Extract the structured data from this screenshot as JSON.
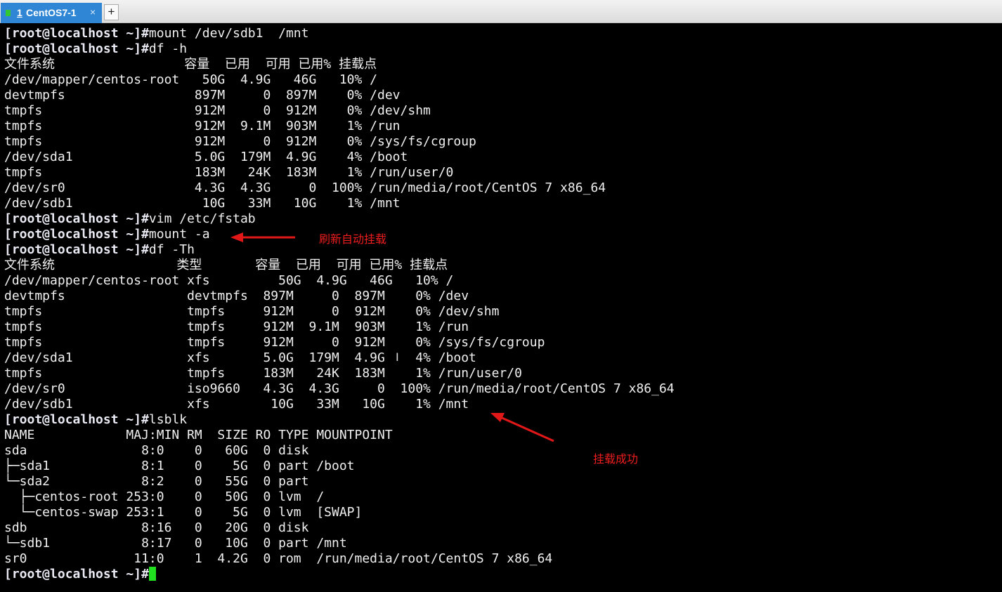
{
  "tab": {
    "number": "1",
    "title": "CentOS7-1",
    "close": "×",
    "new": "+"
  },
  "colors": {
    "tab_active": "#2f86d4",
    "status_dot": "#34c734",
    "annotation": "#f01e1e",
    "cursor": "#20e020"
  },
  "prompt": "[root@localhost ~]#",
  "lines": [
    {
      "prompt": "[root@localhost ~]#",
      "cmd": "mount /dev/sdb1  /mnt"
    },
    {
      "prompt": "[root@localhost ~]#",
      "cmd": "df -h"
    },
    {
      "text": "文件系统                 容量  已用  可用 已用% 挂载点"
    },
    {
      "text": "/dev/mapper/centos-root   50G  4.9G   46G   10% /"
    },
    {
      "text": "devtmpfs                 897M     0  897M    0% /dev"
    },
    {
      "text": "tmpfs                    912M     0  912M    0% /dev/shm"
    },
    {
      "text": "tmpfs                    912M  9.1M  903M    1% /run"
    },
    {
      "text": "tmpfs                    912M     0  912M    0% /sys/fs/cgroup"
    },
    {
      "text": "/dev/sda1                5.0G  179M  4.9G    4% /boot"
    },
    {
      "text": "tmpfs                    183M   24K  183M    1% /run/user/0"
    },
    {
      "text": "/dev/sr0                 4.3G  4.3G     0  100% /run/media/root/CentOS 7 x86_64"
    },
    {
      "text": "/dev/sdb1                 10G   33M   10G    1% /mnt"
    },
    {
      "prompt": "[root@localhost ~]#",
      "cmd": "vim /etc/fstab"
    },
    {
      "prompt": "[root@localhost ~]#",
      "cmd": "mount -a"
    },
    {
      "prompt": "[root@localhost ~]#",
      "cmd": "df -Th"
    },
    {
      "text": "文件系统                类型       容量  已用  可用 已用% 挂载点"
    },
    {
      "text": "/dev/mapper/centos-root xfs         50G  4.9G   46G   10% /"
    },
    {
      "text": "devtmpfs                devtmpfs  897M     0  897M    0% /dev"
    },
    {
      "text": "tmpfs                   tmpfs     912M     0  912M    0% /dev/shm"
    },
    {
      "text": "tmpfs                   tmpfs     912M  9.1M  903M    1% /run"
    },
    {
      "text": "tmpfs                   tmpfs     912M     0  912M    0% /sys/fs/cgroup"
    },
    {
      "text": "/dev/sda1               xfs       5.0G  179M  4.9G    4% /boot"
    },
    {
      "text": "tmpfs                   tmpfs     183M   24K  183M    1% /run/user/0"
    },
    {
      "text": "/dev/sr0                iso9660   4.3G  4.3G     0  100% /run/media/root/CentOS 7 x86_64"
    },
    {
      "text": "/dev/sdb1               xfs        10G   33M   10G    1% /mnt"
    },
    {
      "prompt": "[root@localhost ~]#",
      "cmd": "lsblk"
    },
    {
      "text": "NAME            MAJ:MIN RM  SIZE RO TYPE MOUNTPOINT"
    },
    {
      "text": "sda               8:0    0   60G  0 disk "
    },
    {
      "text": "├─sda1            8:1    0    5G  0 part /boot"
    },
    {
      "text": "└─sda2            8:2    0   55G  0 part "
    },
    {
      "text": "  ├─centos-root 253:0    0   50G  0 lvm  /"
    },
    {
      "text": "  └─centos-swap 253:1    0    5G  0 lvm  [SWAP]"
    },
    {
      "text": "sdb               8:16   0   20G  0 disk "
    },
    {
      "text": "└─sdb1            8:17   0   10G  0 part /mnt"
    },
    {
      "text": "sr0              11:0    1  4.2G  0 rom  /run/media/root/CentOS 7 x86_64"
    },
    {
      "prompt": "[root@localhost ~]#",
      "cmd": "",
      "cursor": true
    }
  ],
  "annotations": {
    "refresh": "刷新自动挂载",
    "success": "挂载成功"
  }
}
